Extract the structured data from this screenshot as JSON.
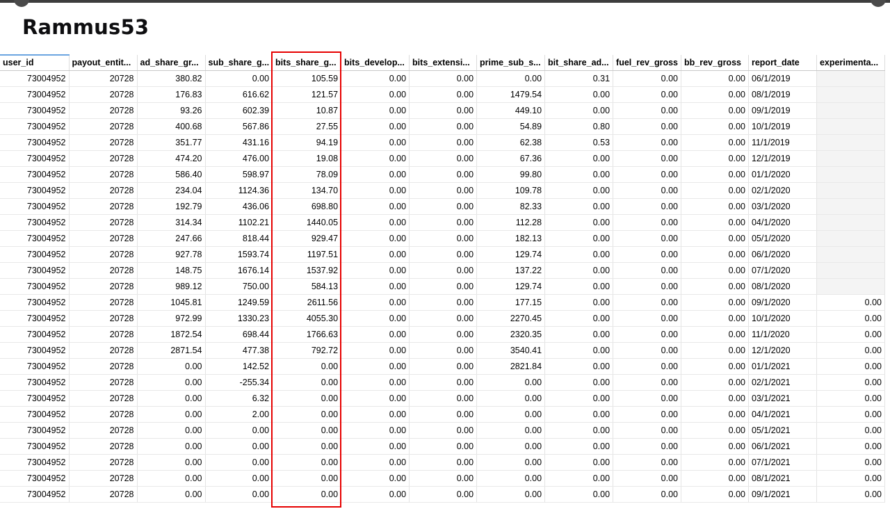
{
  "page": {
    "title": "Rammus53"
  },
  "table": {
    "columns": [
      "user_id",
      "payout_entit...",
      "ad_share_gr...",
      "sub_share_g...",
      "bits_share_g...",
      "bits_develop...",
      "bits_extensi...",
      "prime_sub_s...",
      "bit_share_ad...",
      "fuel_rev_gross",
      "bb_rev_gross",
      "report_date",
      "experimenta..."
    ],
    "rows": [
      [
        "73004952",
        "20728",
        "380.82",
        "0.00",
        "105.59",
        "0.00",
        "0.00",
        "0.00",
        "0.31",
        "0.00",
        "0.00",
        "06/1/2019",
        ""
      ],
      [
        "73004952",
        "20728",
        "176.83",
        "616.62",
        "121.57",
        "0.00",
        "0.00",
        "1479.54",
        "0.00",
        "0.00",
        "0.00",
        "08/1/2019",
        ""
      ],
      [
        "73004952",
        "20728",
        "93.26",
        "602.39",
        "10.87",
        "0.00",
        "0.00",
        "449.10",
        "0.00",
        "0.00",
        "0.00",
        "09/1/2019",
        ""
      ],
      [
        "73004952",
        "20728",
        "400.68",
        "567.86",
        "27.55",
        "0.00",
        "0.00",
        "54.89",
        "0.80",
        "0.00",
        "0.00",
        "10/1/2019",
        ""
      ],
      [
        "73004952",
        "20728",
        "351.77",
        "431.16",
        "94.19",
        "0.00",
        "0.00",
        "62.38",
        "0.53",
        "0.00",
        "0.00",
        "11/1/2019",
        ""
      ],
      [
        "73004952",
        "20728",
        "474.20",
        "476.00",
        "19.08",
        "0.00",
        "0.00",
        "67.36",
        "0.00",
        "0.00",
        "0.00",
        "12/1/2019",
        ""
      ],
      [
        "73004952",
        "20728",
        "586.40",
        "598.97",
        "78.09",
        "0.00",
        "0.00",
        "99.80",
        "0.00",
        "0.00",
        "0.00",
        "01/1/2020",
        ""
      ],
      [
        "73004952",
        "20728",
        "234.04",
        "1124.36",
        "134.70",
        "0.00",
        "0.00",
        "109.78",
        "0.00",
        "0.00",
        "0.00",
        "02/1/2020",
        ""
      ],
      [
        "73004952",
        "20728",
        "192.79",
        "436.06",
        "698.80",
        "0.00",
        "0.00",
        "82.33",
        "0.00",
        "0.00",
        "0.00",
        "03/1/2020",
        ""
      ],
      [
        "73004952",
        "20728",
        "314.34",
        "1102.21",
        "1440.05",
        "0.00",
        "0.00",
        "112.28",
        "0.00",
        "0.00",
        "0.00",
        "04/1/2020",
        ""
      ],
      [
        "73004952",
        "20728",
        "247.66",
        "818.44",
        "929.47",
        "0.00",
        "0.00",
        "182.13",
        "0.00",
        "0.00",
        "0.00",
        "05/1/2020",
        ""
      ],
      [
        "73004952",
        "20728",
        "927.78",
        "1593.74",
        "1197.51",
        "0.00",
        "0.00",
        "129.74",
        "0.00",
        "0.00",
        "0.00",
        "06/1/2020",
        ""
      ],
      [
        "73004952",
        "20728",
        "148.75",
        "1676.14",
        "1537.92",
        "0.00",
        "0.00",
        "137.22",
        "0.00",
        "0.00",
        "0.00",
        "07/1/2020",
        ""
      ],
      [
        "73004952",
        "20728",
        "989.12",
        "750.00",
        "584.13",
        "0.00",
        "0.00",
        "129.74",
        "0.00",
        "0.00",
        "0.00",
        "08/1/2020",
        ""
      ],
      [
        "73004952",
        "20728",
        "1045.81",
        "1249.59",
        "2611.56",
        "0.00",
        "0.00",
        "177.15",
        "0.00",
        "0.00",
        "0.00",
        "09/1/2020",
        "0.00"
      ],
      [
        "73004952",
        "20728",
        "972.99",
        "1330.23",
        "4055.30",
        "0.00",
        "0.00",
        "2270.45",
        "0.00",
        "0.00",
        "0.00",
        "10/1/2020",
        "0.00"
      ],
      [
        "73004952",
        "20728",
        "1872.54",
        "698.44",
        "1766.63",
        "0.00",
        "0.00",
        "2320.35",
        "0.00",
        "0.00",
        "0.00",
        "11/1/2020",
        "0.00"
      ],
      [
        "73004952",
        "20728",
        "2871.54",
        "477.38",
        "792.72",
        "0.00",
        "0.00",
        "3540.41",
        "0.00",
        "0.00",
        "0.00",
        "12/1/2020",
        "0.00"
      ],
      [
        "73004952",
        "20728",
        "0.00",
        "142.52",
        "0.00",
        "0.00",
        "0.00",
        "2821.84",
        "0.00",
        "0.00",
        "0.00",
        "01/1/2021",
        "0.00"
      ],
      [
        "73004952",
        "20728",
        "0.00",
        "-255.34",
        "0.00",
        "0.00",
        "0.00",
        "0.00",
        "0.00",
        "0.00",
        "0.00",
        "02/1/2021",
        "0.00"
      ],
      [
        "73004952",
        "20728",
        "0.00",
        "6.32",
        "0.00",
        "0.00",
        "0.00",
        "0.00",
        "0.00",
        "0.00",
        "0.00",
        "03/1/2021",
        "0.00"
      ],
      [
        "73004952",
        "20728",
        "0.00",
        "2.00",
        "0.00",
        "0.00",
        "0.00",
        "0.00",
        "0.00",
        "0.00",
        "0.00",
        "04/1/2021",
        "0.00"
      ],
      [
        "73004952",
        "20728",
        "0.00",
        "0.00",
        "0.00",
        "0.00",
        "0.00",
        "0.00",
        "0.00",
        "0.00",
        "0.00",
        "05/1/2021",
        "0.00"
      ],
      [
        "73004952",
        "20728",
        "0.00",
        "0.00",
        "0.00",
        "0.00",
        "0.00",
        "0.00",
        "0.00",
        "0.00",
        "0.00",
        "06/1/2021",
        "0.00"
      ],
      [
        "73004952",
        "20728",
        "0.00",
        "0.00",
        "0.00",
        "0.00",
        "0.00",
        "0.00",
        "0.00",
        "0.00",
        "0.00",
        "07/1/2021",
        "0.00"
      ],
      [
        "73004952",
        "20728",
        "0.00",
        "0.00",
        "0.00",
        "0.00",
        "0.00",
        "0.00",
        "0.00",
        "0.00",
        "0.00",
        "08/1/2021",
        "0.00"
      ],
      [
        "73004952",
        "20728",
        "0.00",
        "0.00",
        "0.00",
        "0.00",
        "0.00",
        "0.00",
        "0.00",
        "0.00",
        "0.00",
        "09/1/2021",
        "0.00"
      ]
    ]
  },
  "colors": {
    "highlight_border": "#e60000",
    "sort_indicator": "#6aa4e0"
  }
}
